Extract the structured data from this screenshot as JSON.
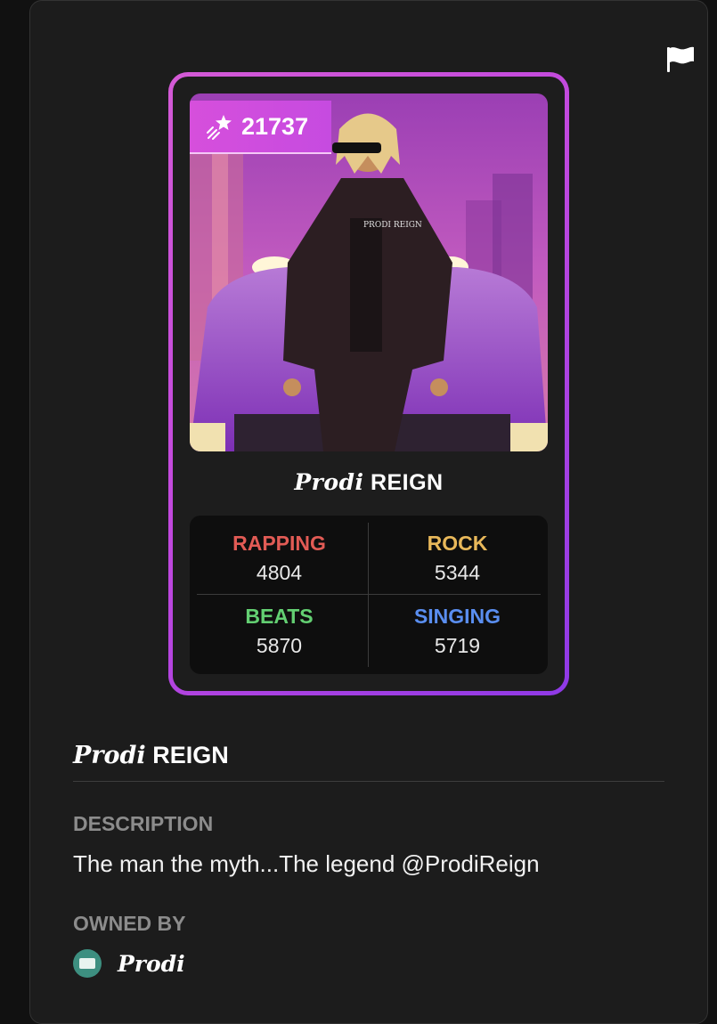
{
  "card": {
    "score": "21737",
    "title_prefix": "Prodi",
    "title_suffix": "REIGN",
    "stats": [
      {
        "label": "RAPPING",
        "value": "4804",
        "color": "#e25b55"
      },
      {
        "label": "ROCK",
        "value": "5344",
        "color": "#e8b85a"
      },
      {
        "label": "BEATS",
        "value": "5870",
        "color": "#63cf72"
      },
      {
        "label": "SINGING",
        "value": "5719",
        "color": "#5a8ef0"
      }
    ],
    "art_text": "PRODI REIGN"
  },
  "details": {
    "title_prefix": "Prodi",
    "title_suffix": "REIGN",
    "description_label": "DESCRIPTION",
    "description": "The man the myth...The legend @ProdiReign",
    "owned_by_label": "OWNED BY",
    "owner_name": "Prodi"
  },
  "icons": {
    "flag": "flag-icon",
    "score": "shooting-star-icon",
    "avatar": "avatar"
  },
  "colors": {
    "frame_start": "#d45ad6",
    "frame_end": "#8f39e6",
    "badge": "#d64fdc"
  }
}
